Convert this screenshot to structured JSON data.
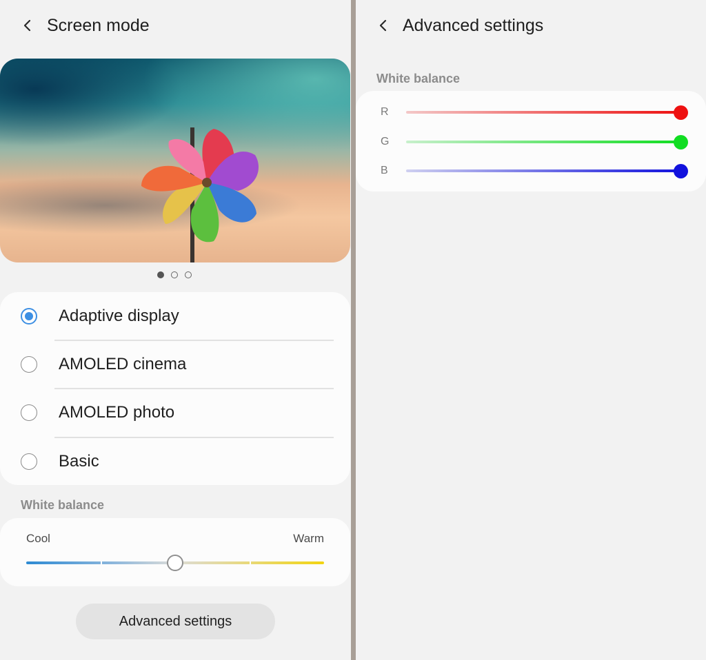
{
  "left": {
    "header": {
      "title": "Screen mode"
    },
    "carousel": {
      "page_count": 3,
      "active_index": 0
    },
    "modes": [
      {
        "label": "Adaptive display",
        "selected": true
      },
      {
        "label": "AMOLED cinema",
        "selected": false
      },
      {
        "label": "AMOLED photo",
        "selected": false
      },
      {
        "label": "Basic",
        "selected": false
      }
    ],
    "white_balance": {
      "section_title": "White balance",
      "cool_label": "Cool",
      "warm_label": "Warm",
      "level": 0.5
    },
    "advanced_button": {
      "label": "Advanced settings"
    }
  },
  "right": {
    "header": {
      "title": "Advanced settings"
    },
    "white_balance": {
      "section_title": "White balance",
      "channels": [
        {
          "label": "R",
          "value": 1.0,
          "color": "#ee1111",
          "track_start": "#f3c8c8"
        },
        {
          "label": "G",
          "value": 1.0,
          "color": "#11dd22",
          "track_start": "#c8f0cc"
        },
        {
          "label": "B",
          "value": 1.0,
          "color": "#1111dd",
          "track_start": "#cfd0f0"
        }
      ]
    }
  },
  "colors": {
    "accent": "#3d8fe3",
    "background": "#f2f2f2",
    "card": "#fcfcfc"
  }
}
